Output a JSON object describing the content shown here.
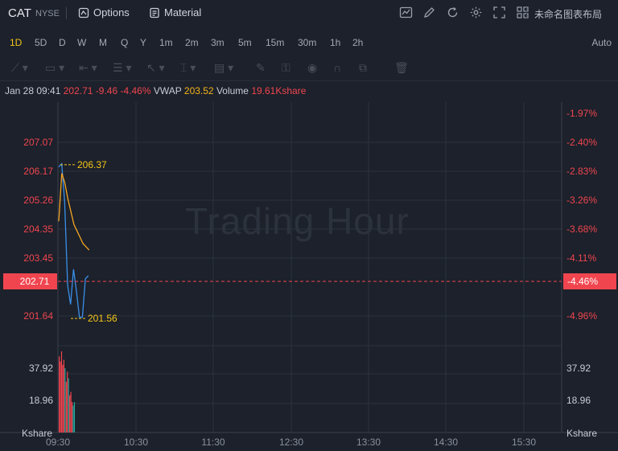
{
  "header": {
    "symbol": "CAT",
    "exchange": "NYSE",
    "options_label": "Options",
    "material_label": "Material",
    "layout_label": "未命名图表布局"
  },
  "intervals": [
    "1D",
    "5D",
    "D",
    "W",
    "M",
    "Q",
    "Y",
    "1m",
    "2m",
    "3m",
    "5m",
    "15m",
    "30m",
    "1h",
    "2h"
  ],
  "active_interval": "1D",
  "scale_mode": "Auto",
  "legend": {
    "date_time": "Jan 28 09:41",
    "price": "202.71",
    "change": "-9.46",
    "change_pct": "-4.46%",
    "vwap_label": "VWAP",
    "vwap_value": "203.52",
    "volume_label": "Volume",
    "volume_value": "19.61Kshare"
  },
  "watermark": "Trading Hour",
  "colors": {
    "up": "#26a69a",
    "down": "#f0454f",
    "price_line": "#3a8fe8",
    "vwap_line": "#f5a623",
    "annotation": "#f5c518"
  },
  "chart_data": {
    "type": "line",
    "price_axis_left": [
      "207.07",
      "206.17",
      "205.26",
      "204.35",
      "203.45",
      "202.71",
      "201.64"
    ],
    "price_axis_right": [
      "-1.97%",
      "-2.40%",
      "-2.83%",
      "-3.26%",
      "-3.68%",
      "-4.11%",
      "-4.46%",
      "-4.96%"
    ],
    "volume_axis": [
      "37.92",
      "18.96"
    ],
    "volume_unit": "Kshare",
    "x_ticks": [
      "09:30",
      "10:30",
      "11:30",
      "12:30",
      "13:30",
      "14:30",
      "15:30"
    ],
    "current_price": "202.71",
    "current_pct": "-4.46%",
    "high_label": "206.37",
    "low_label": "201.56",
    "series": [
      {
        "values": [
          206.3,
          206.4,
          205.2,
          202.6,
          202.0,
          203.1,
          202.4,
          201.6,
          201.6,
          202.8,
          202.9
        ]
      },
      {
        "values": [
          204.6,
          206.1,
          205.8,
          205.3,
          204.9,
          204.5,
          204.3,
          204.1,
          203.9,
          203.8,
          203.7
        ]
      }
    ],
    "volume": [
      {
        "v": 45,
        "up": false
      },
      {
        "v": 42,
        "up": false
      },
      {
        "v": 48,
        "up": false
      },
      {
        "v": 40,
        "up": false
      },
      {
        "v": 43,
        "up": false
      },
      {
        "v": 38,
        "up": true
      },
      {
        "v": 30,
        "up": false
      },
      {
        "v": 36,
        "up": false
      },
      {
        "v": 32,
        "up": true
      },
      {
        "v": 22,
        "up": false
      },
      {
        "v": 24,
        "up": false
      },
      {
        "v": 18,
        "up": false
      },
      {
        "v": 16,
        "up": true
      },
      {
        "v": 18,
        "up": true
      }
    ]
  }
}
